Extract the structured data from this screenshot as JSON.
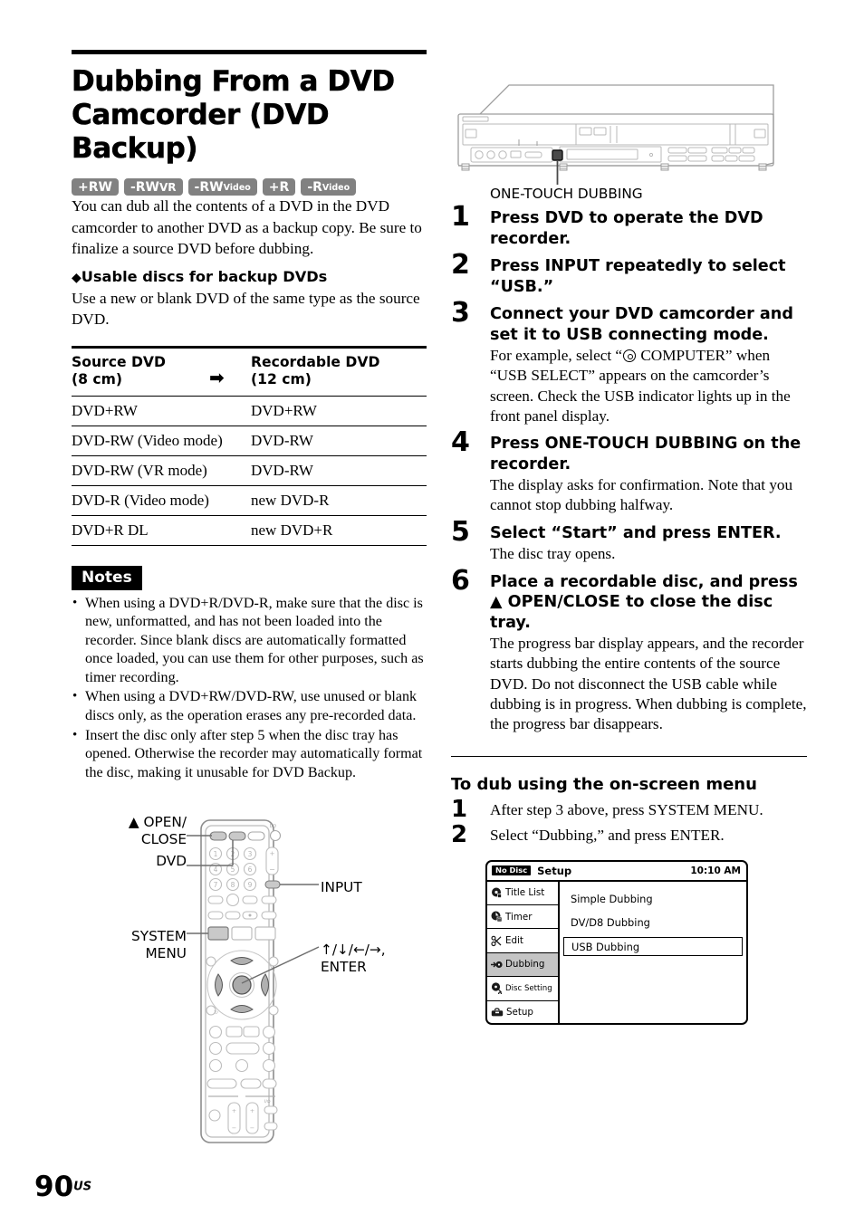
{
  "page": {
    "number": "90",
    "suffix": "US"
  },
  "left": {
    "title": "Dubbing From a DVD Camcorder (DVD Backup)",
    "badges": [
      {
        "name": "plus-rw-badge",
        "main": "+RW",
        "sub": ""
      },
      {
        "name": "minus-rw-vr-badge",
        "main": "-RW",
        "sub": "VR",
        "sub_style": "vr"
      },
      {
        "name": "minus-rw-video-badge",
        "main": "-RW",
        "sub": "Video"
      },
      {
        "name": "plus-r-badge",
        "main": "+R",
        "sub": ""
      },
      {
        "name": "minus-r-video-badge",
        "main": "-R",
        "sub": "Video"
      }
    ],
    "intro": "You can dub all the contents of a DVD in the DVD camcorder to another DVD as a backup copy. Be sure to finalize a source DVD before dubbing.",
    "usable_heading": "Usable discs for backup DVDs",
    "usable_body": "Use a new or blank DVD of the same type as the source DVD.",
    "table": {
      "headers": {
        "source": "Source DVD\n(8 cm)",
        "source_line1": "Source DVD",
        "source_line2": "(8 cm)",
        "arrow": "➡",
        "recordable_line1": "Recordable DVD",
        "recordable_line2": "(12 cm)"
      },
      "rows": [
        {
          "source": "DVD+RW",
          "recordable": "DVD+RW"
        },
        {
          "source": "DVD-RW (Video mode)",
          "recordable": "DVD-RW"
        },
        {
          "source": "DVD-RW (VR mode)",
          "recordable": "DVD-RW"
        },
        {
          "source": "DVD-R (Video mode)",
          "recordable": "new DVD-R"
        },
        {
          "source": "DVD+R DL",
          "recordable": "new DVD+R"
        }
      ]
    },
    "notes_heading": "Notes",
    "notes": [
      "When using a DVD+R/DVD-R, make sure that the disc is new, unformatted, and has not been loaded into the recorder. Since blank discs are automatically formatted once loaded, you can use them for other purposes, such as timer recording.",
      "When using a DVD+RW/DVD-RW, use unused or blank discs only, as the operation erases any pre-recorded data.",
      "Insert the disc only after step 5 when the disc tray has opened. Otherwise the recorder may automatically format the disc, making it unusable for DVD Backup."
    ],
    "remote_labels": {
      "open_close": "▲ OPEN/\nCLOSE",
      "open_close_line1": "▲ OPEN/",
      "open_close_line2": "CLOSE",
      "dvd": "DVD",
      "system_menu_line1": "SYSTEM",
      "system_menu_line2": "MENU",
      "input": "INPUT",
      "enter_line1": "↑/↓/←/→,",
      "enter_line2": "ENTER"
    }
  },
  "right": {
    "recorder_callout": "ONE-TOUCH DUBBING",
    "steps": [
      {
        "num": "1",
        "title": "Press DVD to operate the DVD recorder.",
        "body": ""
      },
      {
        "num": "2",
        "title": "Press INPUT repeatedly to select “USB.”",
        "body": ""
      },
      {
        "num": "3",
        "title": "Connect your DVD camcorder and set it to USB connecting mode.",
        "body_pre": "For example, select “",
        "body_post": " COMPUTER” when “USB SELECT” appears on the camcorder’s screen. Check the USB indicator lights up in the front panel display."
      },
      {
        "num": "4",
        "title": "Press ONE-TOUCH DUBBING on the recorder.",
        "body": "The display asks for confirmation. Note that you cannot stop dubbing halfway."
      },
      {
        "num": "5",
        "title": "Select “Start” and press ENTER.",
        "body": "The disc tray opens."
      },
      {
        "num": "6",
        "title": "Place a recordable disc, and press ▲ OPEN/CLOSE to close the disc tray.",
        "body": "The progress bar display appears, and the recorder starts dubbing the entire contents of the source DVD. Do not disconnect the USB cable while dubbing is in progress. When dubbing is complete, the progress bar disappears."
      }
    ],
    "onscreen_heading": "To dub using the on-screen menu",
    "onscreen_steps": [
      {
        "num": "1",
        "text": "After step 3 above, press SYSTEM MENU."
      },
      {
        "num": "2",
        "text": "Select “Dubbing,” and press ENTER."
      }
    ],
    "menu": {
      "disc_status": "No Disc",
      "title": "Setup",
      "clock": "10:10 AM",
      "sidebar": [
        {
          "label": "Title List",
          "icon": "disc-icon",
          "selected": false
        },
        {
          "label": "Timer",
          "icon": "clock-icon",
          "selected": false
        },
        {
          "label": "Edit",
          "icon": "scissors-icon",
          "selected": false
        },
        {
          "label": "Dubbing",
          "icon": "dubbing-arrow-icon",
          "selected": true
        },
        {
          "label": "Disc Setting",
          "icon": "disc-wrench-icon",
          "selected": false,
          "small": true
        },
        {
          "label": "Setup",
          "icon": "toolbox-icon",
          "selected": false
        }
      ],
      "options": [
        {
          "label": "Simple Dubbing",
          "highlighted": false
        },
        {
          "label": "DV/D8 Dubbing",
          "highlighted": false
        },
        {
          "label": "USB Dubbing",
          "highlighted": true
        }
      ]
    }
  }
}
